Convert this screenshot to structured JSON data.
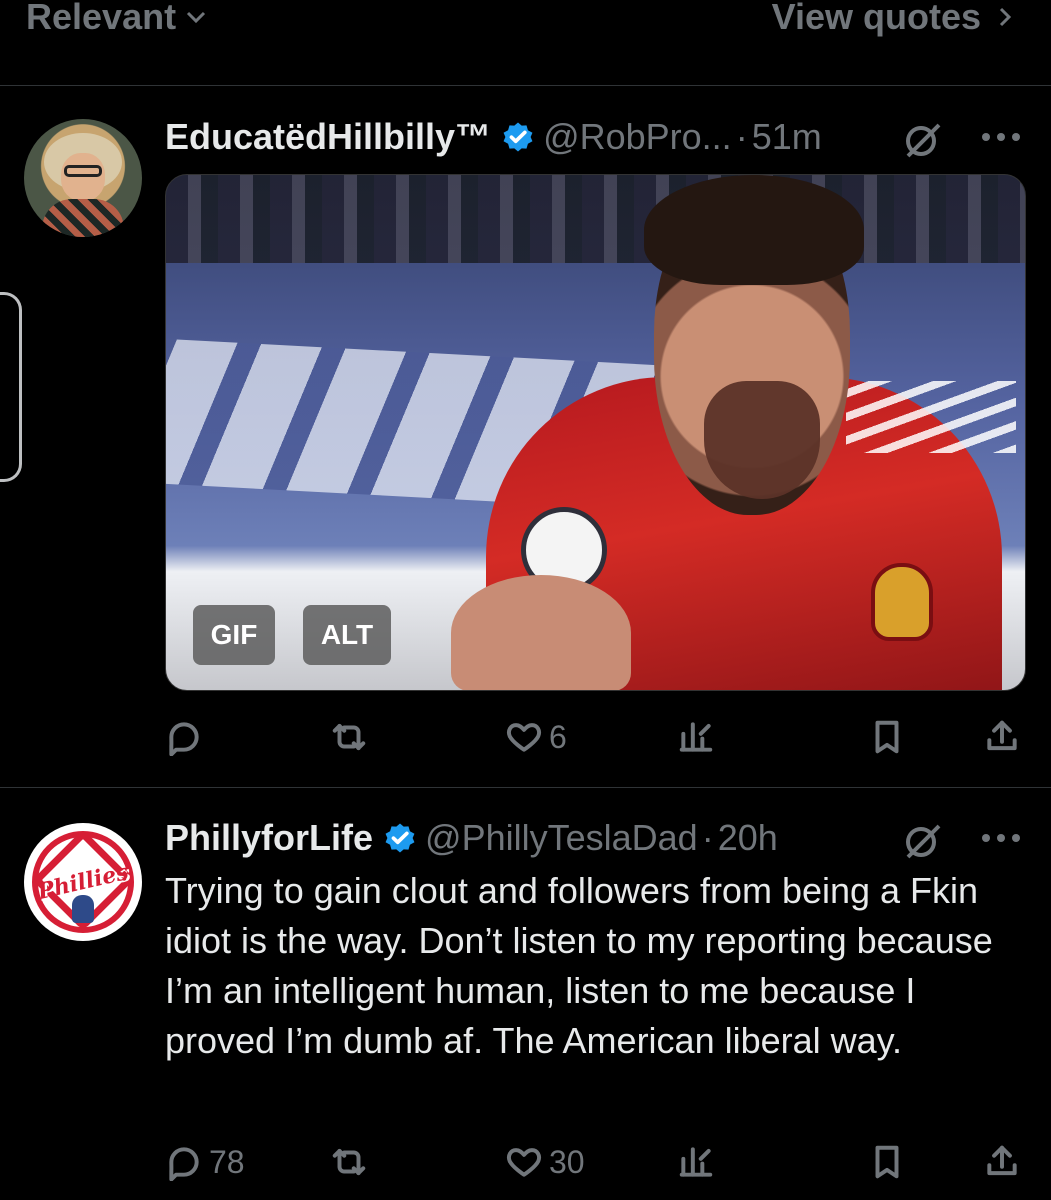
{
  "topbar": {
    "sort_label": "Relevant",
    "quotes_label": "View quotes"
  },
  "tweets": [
    {
      "display_name": "EducatëdHillbilly™",
      "handle": "@RobPro...",
      "separator": "·",
      "time": "51m",
      "media": {
        "gif_label": "GIF",
        "alt_label": "ALT"
      },
      "actions": {
        "reply_count": "",
        "retweet_count": "",
        "like_count": "6"
      }
    },
    {
      "display_name": "PhillyforLife",
      "handle": "@PhillyTeslaDad",
      "separator": "·",
      "time": "20h",
      "text": "Trying to gain clout and followers from being a Fkin idiot is the way. Don’t listen to my reporting because I’m an intelligent human, listen to me because I proved I’m dumb af. The American liberal way.",
      "avatar_logo_text": "Phillies",
      "actions": {
        "reply_count": "78",
        "retweet_count": "",
        "like_count": "30"
      }
    }
  ],
  "icons": {
    "verified": "blue-verified-badge-icon",
    "grok": "grok-slash-icon",
    "more": "more-horizontal-icon",
    "reply": "reply-bubble-icon",
    "retweet": "retweet-icon",
    "like": "heart-icon",
    "views": "bar-chart-icon",
    "bookmark": "bookmark-icon",
    "share": "share-icon"
  },
  "colors": {
    "background": "#000000",
    "primary_text": "#e7e9ea",
    "secondary_text": "#71767b",
    "verified": "#1d9bf0",
    "phillies_red": "#d61e35"
  }
}
